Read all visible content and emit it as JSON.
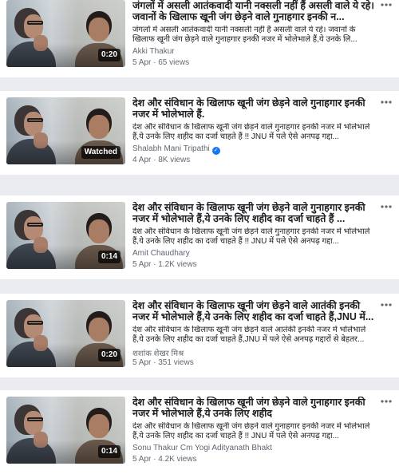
{
  "videos": [
    {
      "title": "जंगलों में असली आतंकवादी यानी नक्सली नहीं हैं असली वाले ये रहे। जवानों के खिलाफ खूनी जंग छेड़ने वाले गुनाहगार इनकी न...",
      "description": "जंगलों में असली आतंकवादी यानी नक्सली नहीं हैं असली वाले ये रहे। जवानों के खिलाफ खूनी जंग छेड़ने वाले गुनाहगार इनकी नजर में भोलेभाले हैं,ये उनके लि...",
      "author": "Akki Thakur",
      "meta": "5 Apr · 65 views",
      "badge": "0:20",
      "verified": false,
      "more_icon": "ellipsis-icon"
    },
    {
      "title": "देश और संविधान के खिलाफ खूनी जंग छेड़ने वाले गुनाहगार इनकी नजर में भोलेभाले हैं.",
      "description": "देश और संविधान के खिलाफ खूनी जंग छेड़ने वाले गुनाहगार इनकी नजर में भोलेभाले हैं,ये उनके लिए शहीद का दर्जा चाहते हैं !! JNU में पले ऐसे अनपढ़ गद्दा...",
      "author": "Shalabh Mani Tripathi",
      "meta": "4 Apr · 8K views",
      "badge": "Watched",
      "verified": true,
      "more_icon": "ellipsis-icon"
    },
    {
      "title": "देश और संविधान के खिलाफ खूनी जंग छेड़ने वाले गुनाहगार इनकी नजर में भोलेभाले हैं,ये उनके लिए शहीद का दर्जा चाहते हैं ...",
      "description": "देश और संविधान के खिलाफ खूनी जंग छेड़ने वाले गुनाहगार इनकी नजर में भोलेभाले हैं,ये उनके लिए शहीद का दर्जा चाहते हैं !! JNU में पले ऐसे अनपढ़ गद्दा...",
      "author": "Amit Chaudhary",
      "meta": "5 Apr · 1.2K views",
      "badge": "0:14",
      "verified": false,
      "more_icon": "ellipsis-icon"
    },
    {
      "title": "देश और संविधान के खिलाफ खूनी जंग छेड़ने वाले आतंकी इनकी नजर में भोलेभाले हैं,ये उनके लिए शहीद का दर्जा चाहते हैं,JNU में...",
      "description": "देश और संविधान के खिलाफ खूनी जंग छेड़ने वाले आतंकी इनकी नजर में भोलेभाले हैं,ये उनके लिए शहीद का दर्जा चाहते हैं,JNU में पले ऐसे अनपढ़ गद्दारों से बेहतर...",
      "author": "शशांक शेखर मिश्र",
      "meta": "5 Apr · 351 views",
      "badge": "0:20",
      "verified": false,
      "more_icon": "ellipsis-icon"
    },
    {
      "title": "देश और संविधान के खिलाफ खूनी जंग छेड़ने वाले गुनाहगार इनकी नजर में भोलेभाले हैं,ये उनके लिए शहीद",
      "description": "देश और संविधान के खिलाफ खूनी जंग छेड़ने वाले गुनाहगार इनकी नजर में भोलेभाले हैं,ये उनके लिए शहीद का दर्जा चाहते हैं !! JNU में पले ऐसे अनपढ़ गद्दा...",
      "author": "Sonu Thakur Cm Yogi Adityanath Bhakt",
      "meta": "5 Apr · 4.2K views",
      "badge": "0:14",
      "verified": false,
      "more_icon": "ellipsis-icon"
    }
  ]
}
